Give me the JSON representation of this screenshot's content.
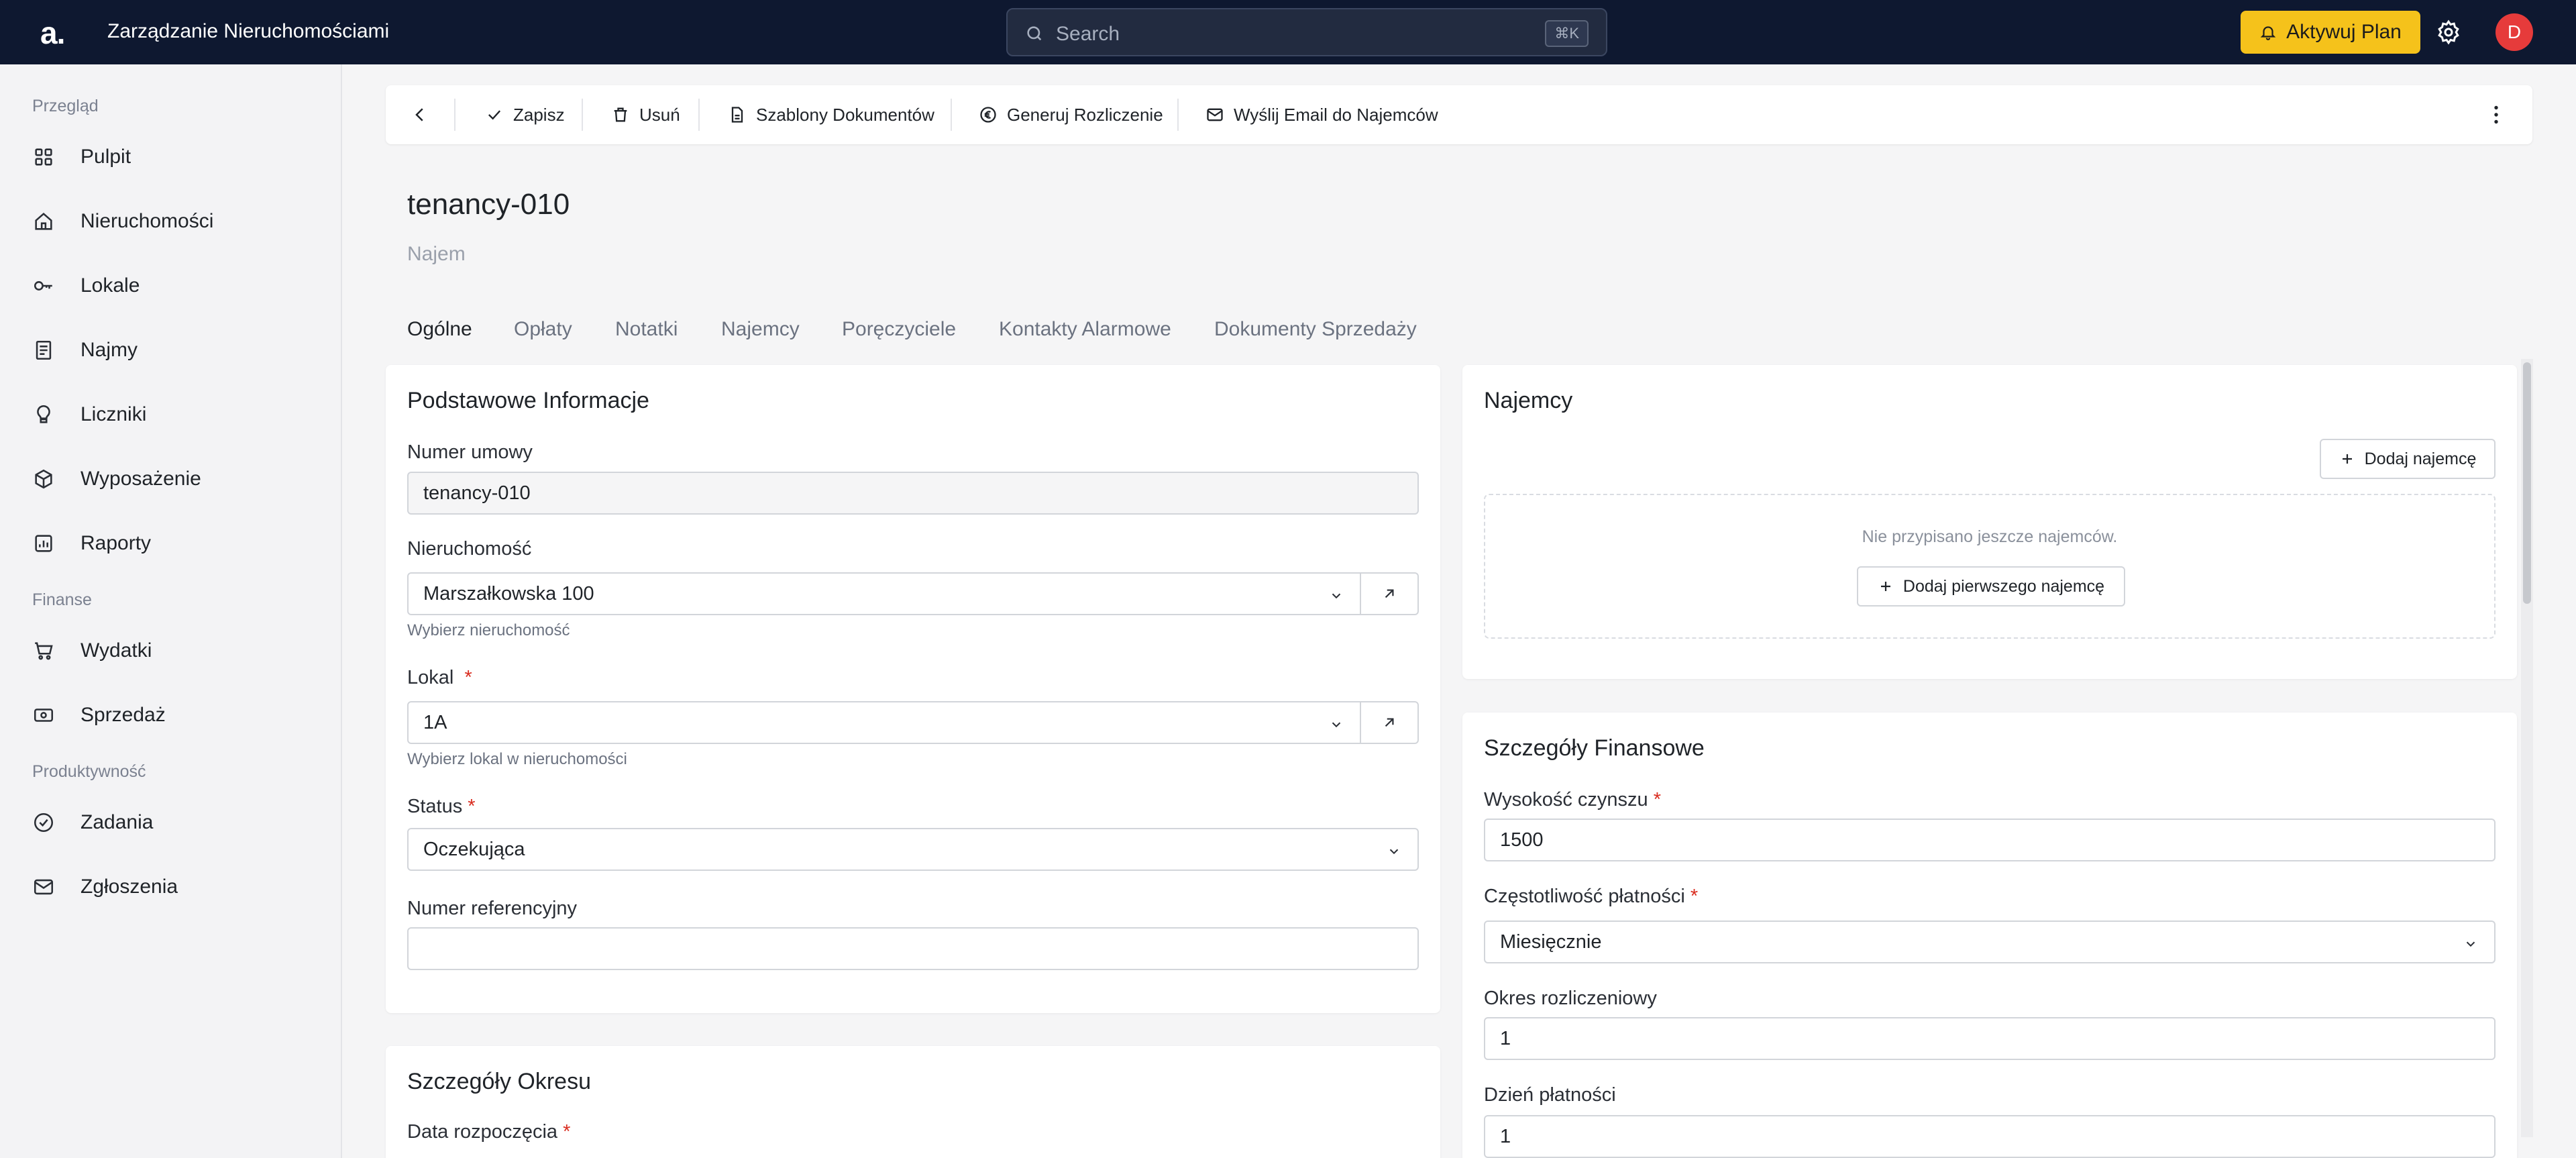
{
  "topbar": {
    "logo": "a.",
    "app_title": "Zarządzanie Nieruchomościami",
    "search_placeholder": "Search",
    "search_shortcut": "⌘K",
    "upgrade_label": "Aktywuj Plan",
    "avatar_initial": "D"
  },
  "sidebar": {
    "sections": [
      {
        "label": "Przegląd",
        "items": [
          {
            "label": "Pulpit",
            "icon": "grid-icon"
          },
          {
            "label": "Nieruchomości",
            "icon": "home-icon"
          },
          {
            "label": "Lokale",
            "icon": "key-icon"
          },
          {
            "label": "Najmy",
            "icon": "document-icon"
          },
          {
            "label": "Liczniki",
            "icon": "lightbulb-icon"
          },
          {
            "label": "Wyposażenie",
            "icon": "box-icon"
          },
          {
            "label": "Raporty",
            "icon": "report-icon"
          }
        ]
      },
      {
        "label": "Finanse",
        "items": [
          {
            "label": "Wydatki",
            "icon": "cart-icon"
          },
          {
            "label": "Sprzedaż",
            "icon": "banknote-icon"
          }
        ]
      },
      {
        "label": "Produktywność",
        "items": [
          {
            "label": "Zadania",
            "icon": "check-circle-icon"
          },
          {
            "label": "Zgłoszenia",
            "icon": "mail-icon"
          }
        ]
      }
    ]
  },
  "toolbar": {
    "save": "Zapisz",
    "delete": "Usuń",
    "templates": "Szablony Dokumentów",
    "settlement": "Generuj Rozliczenie",
    "email": "Wyślij Email do Najemców"
  },
  "document": {
    "title": "tenancy-010",
    "subtitle": "Najem"
  },
  "tabs": [
    "Ogólne",
    "Opłaty",
    "Notatki",
    "Najemcy",
    "Poręczyciele",
    "Kontakty Alarmowe",
    "Dokumenty Sprzedaży"
  ],
  "basic_info": {
    "title": "Podstawowe Informacje",
    "contract_label": "Numer umowy",
    "contract_value": "tenancy-010",
    "property_label": "Nieruchomość",
    "property_value": "Marszałkowska 100",
    "property_hint": "Wybierz nieruchomość",
    "unit_label": "Lokal",
    "unit_value": "1A",
    "unit_hint": "Wybierz lokal w nieruchomości",
    "status_label": "Status",
    "status_value": "Oczekująca",
    "reference_label": "Numer referencyjny",
    "reference_value": ""
  },
  "period": {
    "title": "Szczegóły Okresu",
    "start_label": "Data rozpoczęcia"
  },
  "tenants": {
    "title": "Najemcy",
    "add_label": "Dodaj najemcę",
    "empty_text": "Nie przypisano jeszcze najemców.",
    "add_first_label": "Dodaj pierwszego najemcę"
  },
  "financial": {
    "title": "Szczegóły Finansowe",
    "rent_label": "Wysokość czynszu",
    "rent_value": "1500",
    "frequency_label": "Częstotliwość płatności",
    "frequency_value": "Miesięcznie",
    "period_label": "Okres rozliczeniowy",
    "period_value": "1",
    "payday_label": "Dzień płatności",
    "payday_value": "1"
  },
  "colors": {
    "topbar": "#0e1830",
    "accent": "#f5c21b",
    "avatar": "#e63b3b",
    "required": "#d92d20"
  }
}
